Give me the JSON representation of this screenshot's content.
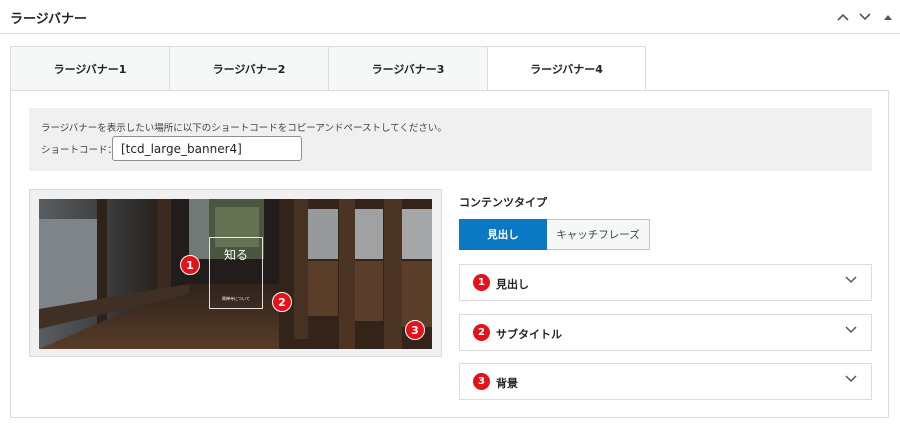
{
  "postbox": {
    "title": "ラージバナー"
  },
  "tabs": [
    {
      "label": "ラージバナー1",
      "active": false
    },
    {
      "label": "ラージバナー2",
      "active": false
    },
    {
      "label": "ラージバナー3",
      "active": false
    },
    {
      "label": "ラージバナー4",
      "active": true
    }
  ],
  "notice": {
    "text": "ラージバナーを表示したい場所に以下のショートコードをコピーアンドペーストしてください。",
    "shortcode_label": "ショートコード：",
    "shortcode_value": "[tcd_large_banner4]"
  },
  "preview": {
    "hero_title": "知る",
    "hero_subtitle": "興禅寺について",
    "badges": [
      "1",
      "2",
      "3"
    ]
  },
  "content_type": {
    "label": "コンテンツタイプ",
    "options": [
      "見出し",
      "キャッチフレーズ"
    ],
    "selected": "見出し"
  },
  "sections": [
    {
      "number": "1",
      "label": "見出し"
    },
    {
      "number": "2",
      "label": "サブタイトル"
    },
    {
      "number": "3",
      "label": "背景"
    }
  ],
  "colors": {
    "accent_blue": "#0a78c2",
    "badge_red": "#e4131a"
  }
}
